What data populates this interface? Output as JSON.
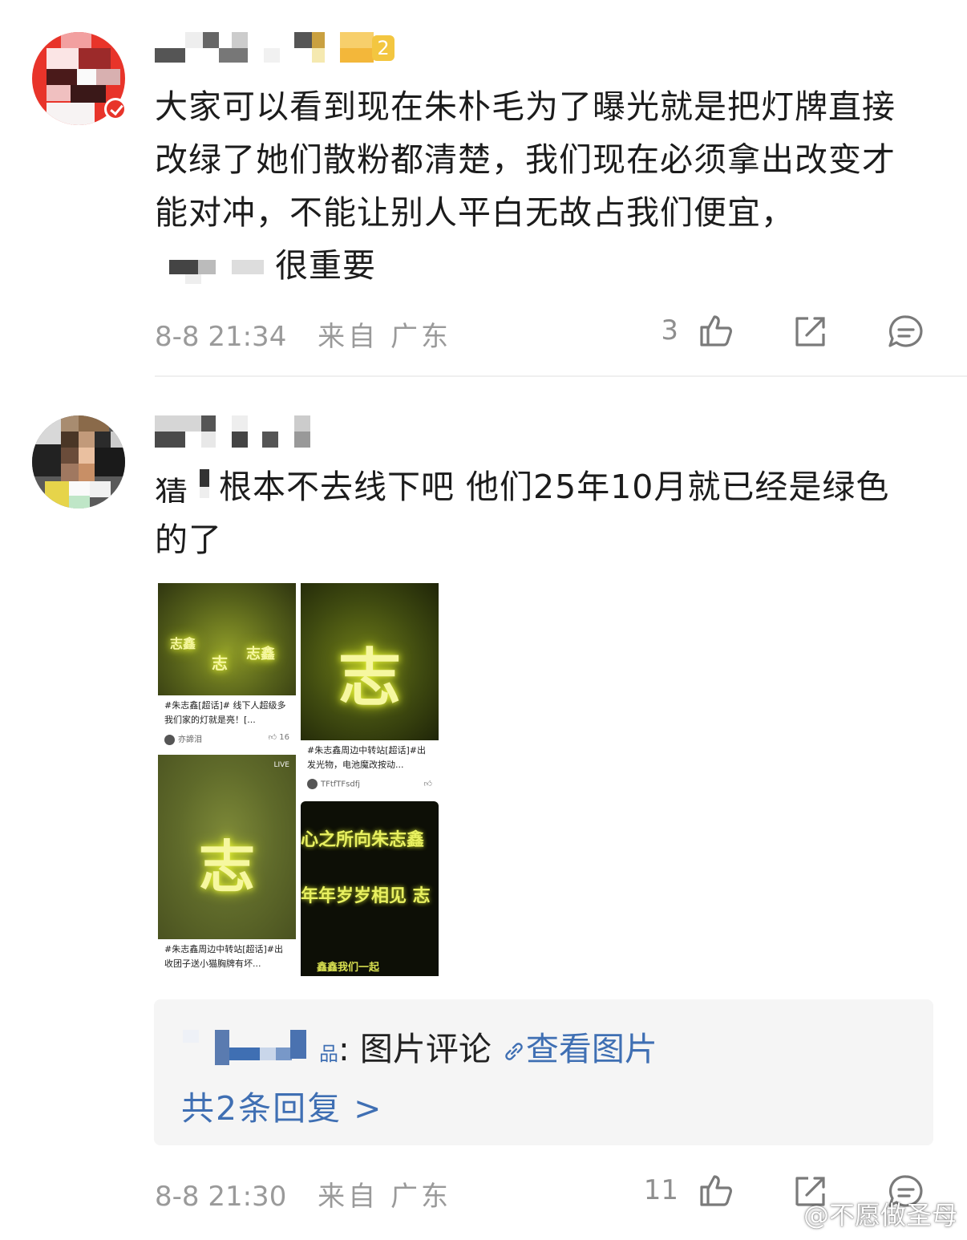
{
  "comments": [
    {
      "text": "大家可以看到现在朱朴毛为了曝光就是把灯牌直接改绿了她们散粉都清楚，我们现在必须拿出改变才能对冲，不能让别人平白无故占我们便宜，",
      "text_tail": "很重要",
      "level": "2",
      "time": "8-8 21:34",
      "location_prefix": "来自",
      "location": "广东",
      "likes": "3"
    },
    {
      "text_head": "猜",
      "text": "根本不去线下吧 他们25年10月就已经是绿色的了",
      "time": "8-8 21:30",
      "location_prefix": "来自",
      "location": "广东",
      "likes": "11",
      "images": [
        {
          "glyph_labels": [
            "志鑫",
            "志",
            "志鑫"
          ],
          "caption": "#朱志鑫[超话]#  线下人超级多 我们家的灯就是亮！[...",
          "author": "亦諦泪",
          "likes": "16"
        },
        {
          "glyph": "志",
          "caption": "#朱志鑫周边中转站[超话]#出发光物，电池魔改按动...",
          "author": "TFtfTFsdfj",
          "likes": ""
        },
        {
          "glyph": "志",
          "live_label": "LIVE",
          "caption": "#朱志鑫周边中转站[超话]#出 收团子送小猫胸牌有坏...",
          "author": "",
          "likes": ""
        },
        {
          "banner_lines": [
            "心之所向朱志鑫",
            "年年岁岁相见 志",
            "鑫鑫我们一起"
          ]
        }
      ],
      "reply": {
        "author_suffix": "品",
        "text": ": 图片评论 ",
        "link_label": "查看图片",
        "count_label": "共2条回复 >"
      }
    }
  ],
  "watermark": "@不愿做圣母",
  "colors": {
    "link": "#3f6fb3",
    "meta": "#9a9a9a",
    "reply_bg": "#f5f5f5",
    "glow": "#d8e63a"
  },
  "icons": [
    "thumbs-up-icon",
    "share-icon",
    "comment-icon",
    "link-icon",
    "weibo-logo"
  ]
}
